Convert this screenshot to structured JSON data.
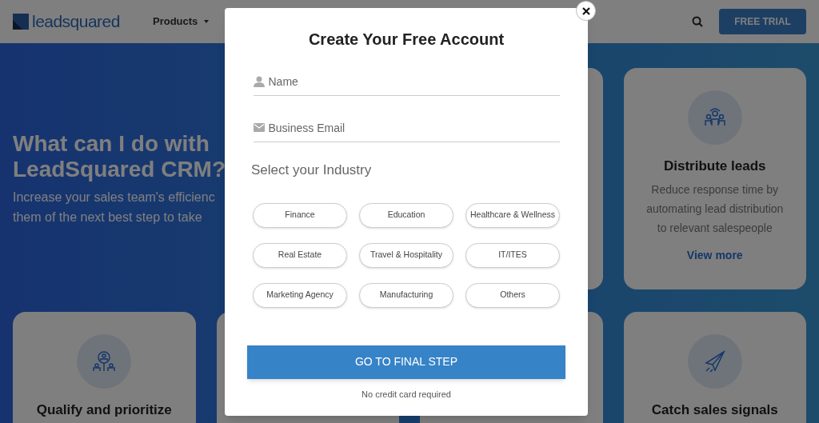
{
  "header": {
    "logo": "leadsquared",
    "nav": [
      {
        "label": "Products"
      }
    ],
    "cta": "FREE TRIAL"
  },
  "hero": {
    "title_lines": [
      "What can I do with",
      "LeadSquared CRM?"
    ],
    "subtitle_lines": [
      "Increase your sales team's efficienc",
      "them of the next best step to take"
    ]
  },
  "cards": [
    {
      "kind": "hidden"
    },
    {
      "kind": "feature",
      "title": "Distribute leads",
      "description": "Reduce response time by automating lead distribution to relevant salespeople",
      "link": "View more"
    },
    {
      "kind": "feature",
      "title": "Qualify and prioritize"
    },
    {
      "kind": "hidden"
    },
    {
      "kind": "hidden"
    },
    {
      "kind": "feature",
      "title": "Catch sales signals"
    }
  ],
  "modal": {
    "title": "Create Your Free Account",
    "fields": [
      {
        "kind": "person",
        "placeholder": "Name"
      },
      {
        "kind": "mail",
        "placeholder": "Business Email"
      }
    ],
    "industry_label": "Select your Industry",
    "industries": [
      {
        "label": "Finance",
        "selected": false
      },
      {
        "label": "Education",
        "selected": false
      },
      {
        "label": "Healthcare & Wellness",
        "selected": false
      },
      {
        "label": "Real Estate",
        "selected": false
      },
      {
        "label": "Travel & Hospitality",
        "selected": false
      },
      {
        "label": "IT/ITES",
        "selected": false
      },
      {
        "label": "Marketing Agency",
        "selected": false
      },
      {
        "label": "Manufacturing",
        "selected": false
      },
      {
        "label": "Others",
        "selected": false
      }
    ],
    "submit": "GO TO FINAL STEP",
    "note": "No credit card required"
  }
}
